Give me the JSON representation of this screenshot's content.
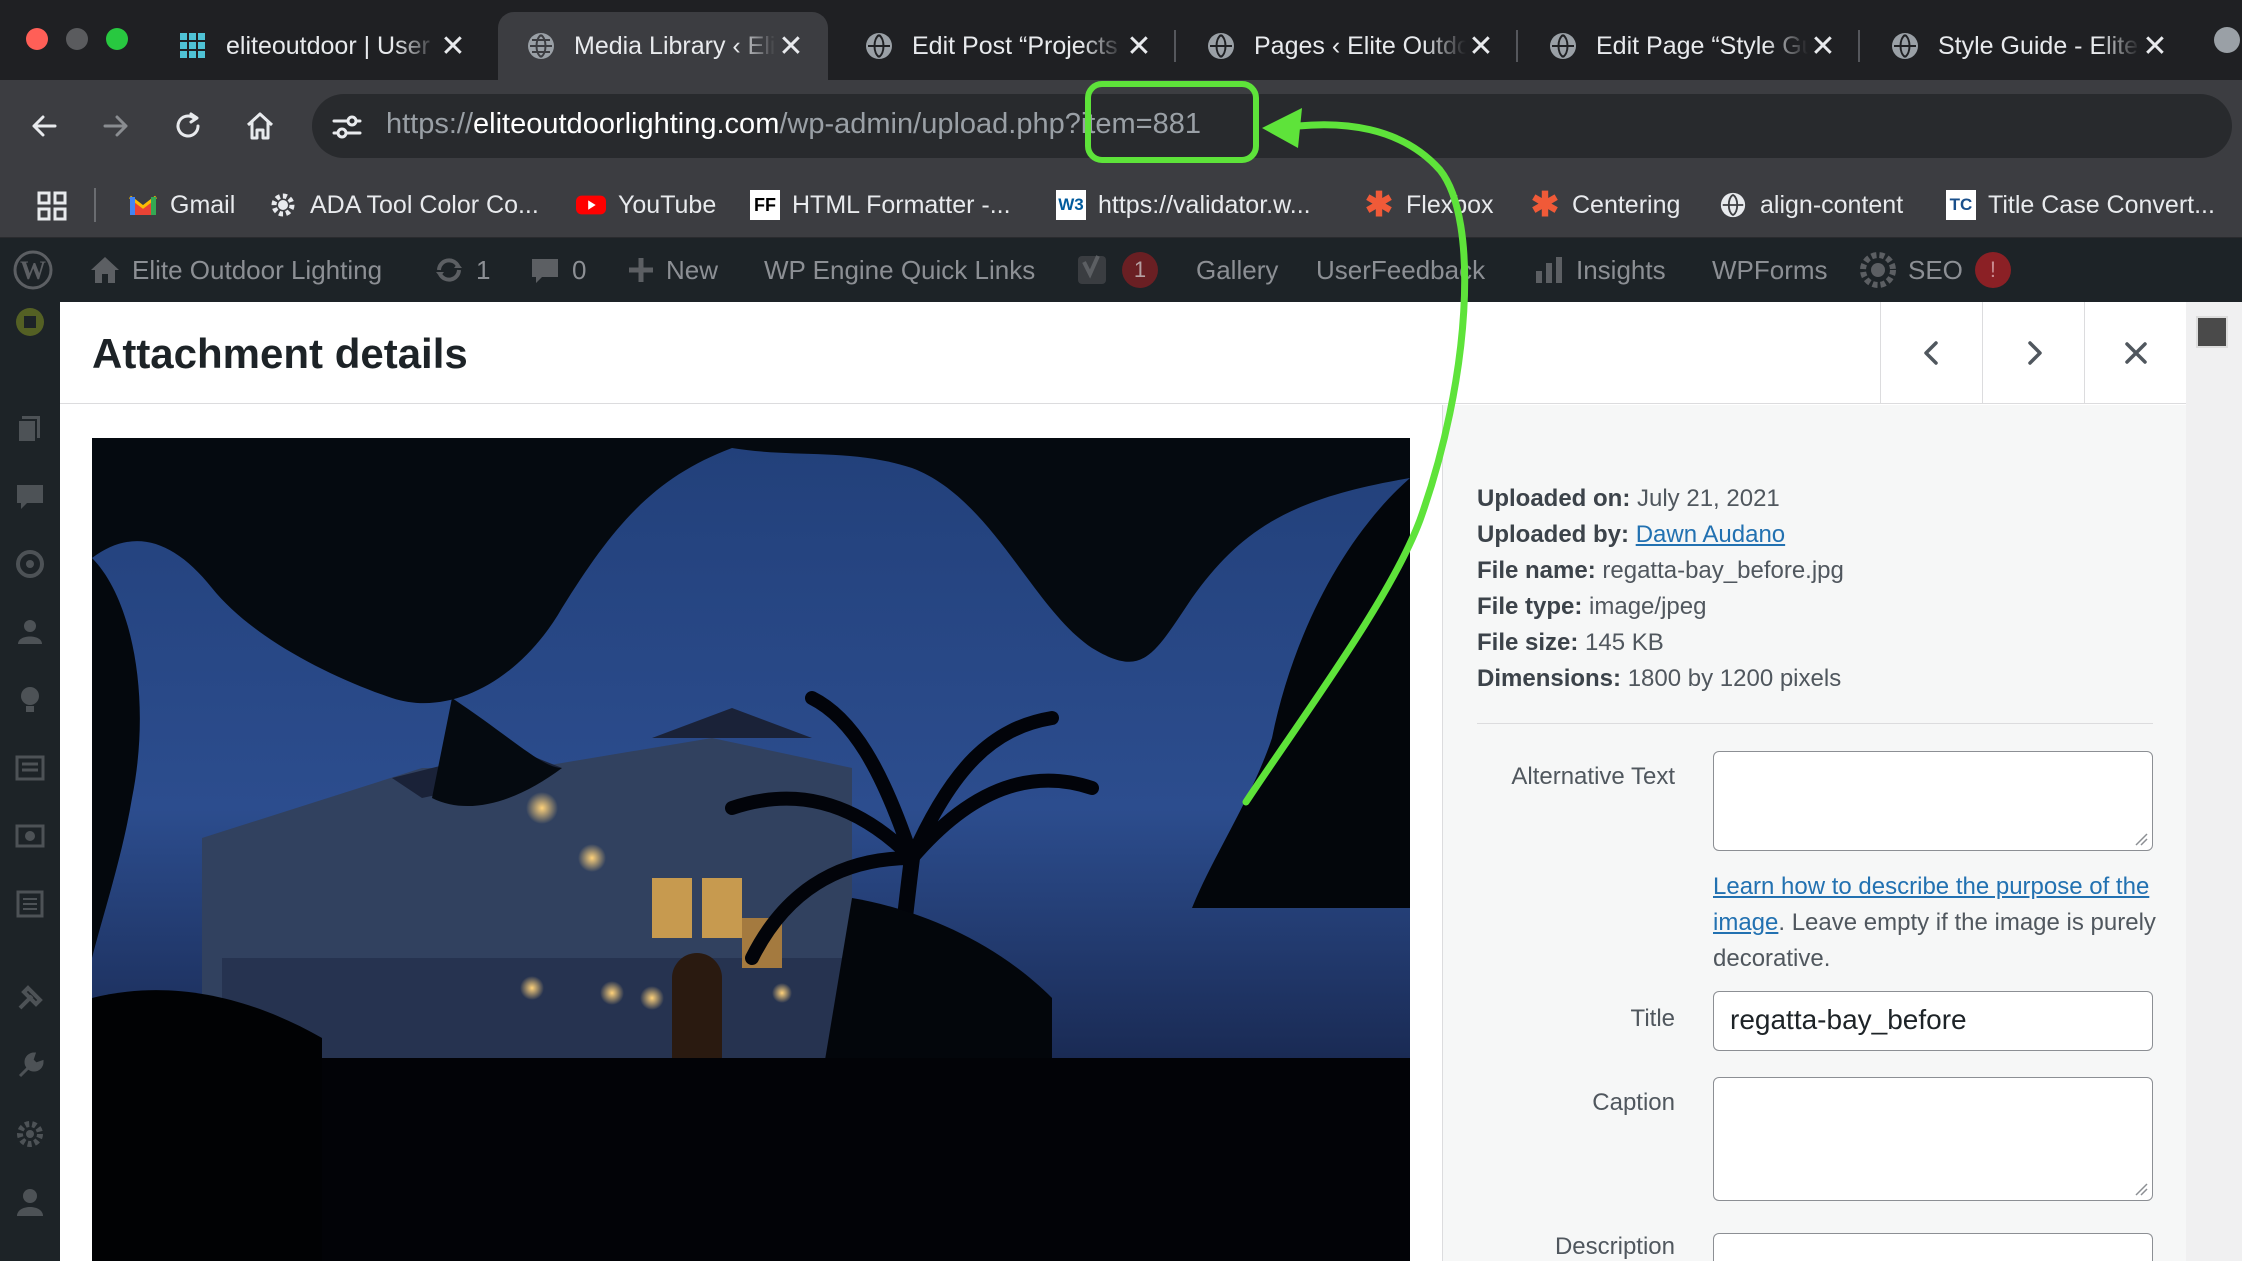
{
  "browser": {
    "tabs": [
      {
        "title": "eliteoutdoor | User",
        "icon": "grid-app-icon"
      },
      {
        "title": "Media Library ‹ Elite",
        "icon": "globe-icon",
        "active": true
      },
      {
        "title": "Edit Post “Projects",
        "icon": "globe-icon"
      },
      {
        "title": "Pages ‹ Elite Outdoor",
        "icon": "globe-icon"
      },
      {
        "title": "Edit Page “Style Guide",
        "icon": "globe-icon"
      },
      {
        "title": "Style Guide - Elite",
        "icon": "globe-icon"
      }
    ],
    "close_glyph": "✕",
    "url": {
      "scheme": "https://",
      "host": "eliteoutdoorlighting.com",
      "path": "/wp-admin/upload.php?item=881"
    },
    "bookmarks": [
      {
        "label": "Gmail",
        "icon": "gmail-icon"
      },
      {
        "label": "ADA Tool Color Co...",
        "icon": "gear-icon"
      },
      {
        "label": "YouTube",
        "icon": "youtube-icon"
      },
      {
        "label": "HTML Formatter -...",
        "icon": "ff-icon"
      },
      {
        "label": "https://validator.w...",
        "icon": "w3c-icon"
      },
      {
        "label": "Flexbox",
        "icon": "asterisk-icon"
      },
      {
        "label": "Centering",
        "icon": "asterisk-icon"
      },
      {
        "label": "align-content",
        "icon": "globe-icon"
      },
      {
        "label": "Title Case Convert...",
        "icon": "tc-icon"
      }
    ],
    "colors": {
      "tabstrip": "#1f2023",
      "toolbar": "#3c3d41",
      "omnibox": "#282a2d"
    }
  },
  "admin_bar": {
    "site_name": "Elite Outdoor Lighting",
    "updates_count": "1",
    "comments_count": "0",
    "new_label": "New",
    "quick_links": "WP Engine Quick Links",
    "yoast_count": "1",
    "gallery": "Gallery",
    "userfeedback": "UserFeedback",
    "insights": "Insights",
    "wpforms": "WPForms",
    "seo": "SEO",
    "seo_badge": "!"
  },
  "modal": {
    "title": "Attachment details",
    "meta": {
      "uploaded_on_label": "Uploaded on:",
      "uploaded_on": "July 21, 2021",
      "uploaded_by_label": "Uploaded by:",
      "uploaded_by": "Dawn Audano",
      "file_name_label": "File name:",
      "file_name": "regatta-bay_before.jpg",
      "file_type_label": "File type:",
      "file_type": "image/jpeg",
      "file_size_label": "File size:",
      "file_size": "145 KB",
      "dimensions_label": "Dimensions:",
      "dimensions": "1800 by 1200 pixels"
    },
    "fields": {
      "alt_label": "Alternative Text",
      "alt_value": "",
      "help_link": "Learn how to describe the purpose of the image",
      "help_text": ". Leave empty if the image is purely decorative.",
      "title_label": "Title",
      "title_value": "regatta-bay_before",
      "caption_label": "Caption",
      "caption_value": "",
      "description_label": "Description"
    },
    "colors": {
      "link": "#2271b1",
      "annotation": "#5ee33a"
    }
  }
}
